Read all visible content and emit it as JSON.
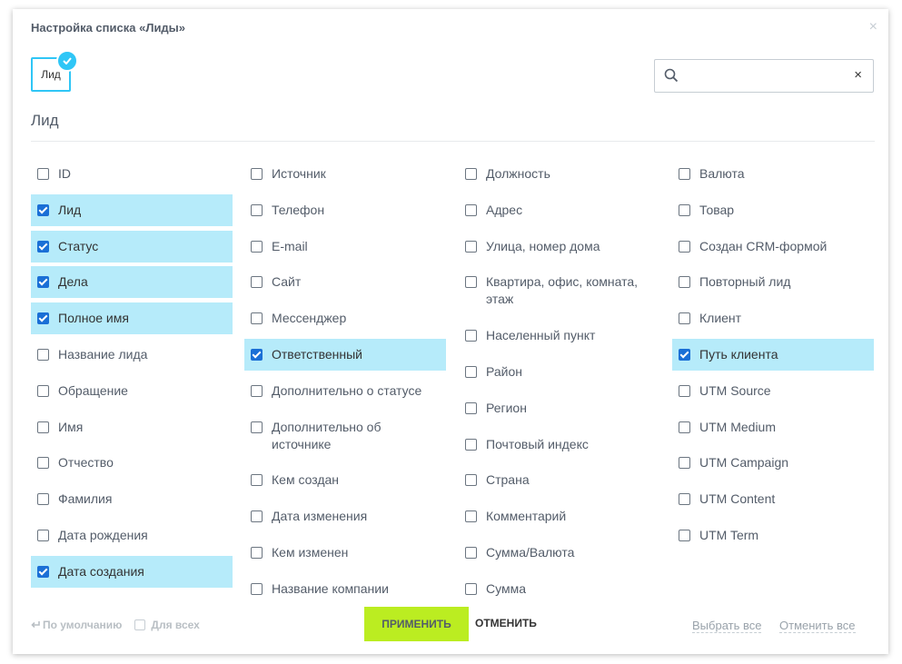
{
  "dialog": {
    "title": "Настройка списка «Лиды»",
    "close_glyph": "×"
  },
  "entity_chip": {
    "label": "Лид",
    "selected": true
  },
  "search": {
    "value": "",
    "placeholder": "",
    "clear_glyph": "×"
  },
  "section_title": "Лид",
  "colors": {
    "accent": "#2fc6f6",
    "checked_bg": "#b6ebfa",
    "apply_btn": "#bbed21",
    "checkbox_checked": "#1a6fd6"
  },
  "columns": [
    [
      {
        "label": "ID",
        "checked": false
      },
      {
        "label": "Лид",
        "checked": true
      },
      {
        "label": "Статус",
        "checked": true
      },
      {
        "label": "Дела",
        "checked": true
      },
      {
        "label": "Полное имя",
        "checked": true
      },
      {
        "label": "Название лида",
        "checked": false
      },
      {
        "label": "Обращение",
        "checked": false
      },
      {
        "label": "Имя",
        "checked": false
      },
      {
        "label": "Отчество",
        "checked": false
      },
      {
        "label": "Фамилия",
        "checked": false
      },
      {
        "label": "Дата рождения",
        "checked": false
      },
      {
        "label": "Дата создания",
        "checked": true
      }
    ],
    [
      {
        "label": "Источник",
        "checked": false
      },
      {
        "label": "Телефон",
        "checked": false
      },
      {
        "label": "E-mail",
        "checked": false
      },
      {
        "label": "Сайт",
        "checked": false
      },
      {
        "label": "Мессенджер",
        "checked": false
      },
      {
        "label": "Ответственный",
        "checked": true
      },
      {
        "label": "Дополнительно о статусе",
        "checked": false
      },
      {
        "label": "Дополнительно об источнике",
        "checked": false
      },
      {
        "label": "Кем создан",
        "checked": false
      },
      {
        "label": "Дата изменения",
        "checked": false
      },
      {
        "label": "Кем изменен",
        "checked": false
      },
      {
        "label": "Название компании",
        "checked": false
      }
    ],
    [
      {
        "label": "Должность",
        "checked": false
      },
      {
        "label": "Адрес",
        "checked": false
      },
      {
        "label": "Улица, номер дома",
        "checked": false
      },
      {
        "label": "Квартира, офис, комната, этаж",
        "checked": false
      },
      {
        "label": "Населенный пункт",
        "checked": false
      },
      {
        "label": "Район",
        "checked": false
      },
      {
        "label": "Регион",
        "checked": false
      },
      {
        "label": "Почтовый индекс",
        "checked": false
      },
      {
        "label": "Страна",
        "checked": false
      },
      {
        "label": "Комментарий",
        "checked": false
      },
      {
        "label": "Сумма/Валюта",
        "checked": false
      },
      {
        "label": "Сумма",
        "checked": false
      }
    ],
    [
      {
        "label": "Валюта",
        "checked": false
      },
      {
        "label": "Товар",
        "checked": false
      },
      {
        "label": "Создан CRM-формой",
        "checked": false
      },
      {
        "label": "Повторный лид",
        "checked": false
      },
      {
        "label": "Клиент",
        "checked": false
      },
      {
        "label": "Путь клиента",
        "checked": true
      },
      {
        "label": "UTM Source",
        "checked": false
      },
      {
        "label": "UTM Medium",
        "checked": false
      },
      {
        "label": "UTM Campaign",
        "checked": false
      },
      {
        "label": "UTM Content",
        "checked": false
      },
      {
        "label": "UTM Term",
        "checked": false
      }
    ]
  ],
  "footer": {
    "reset_label": "По умолчанию",
    "for_all_label": "Для всех",
    "apply_label": "ПРИМЕНИТЬ",
    "cancel_label": "ОТМЕНИТЬ",
    "select_all_label": "Выбрать все",
    "deselect_all_label": "Отменить все"
  }
}
